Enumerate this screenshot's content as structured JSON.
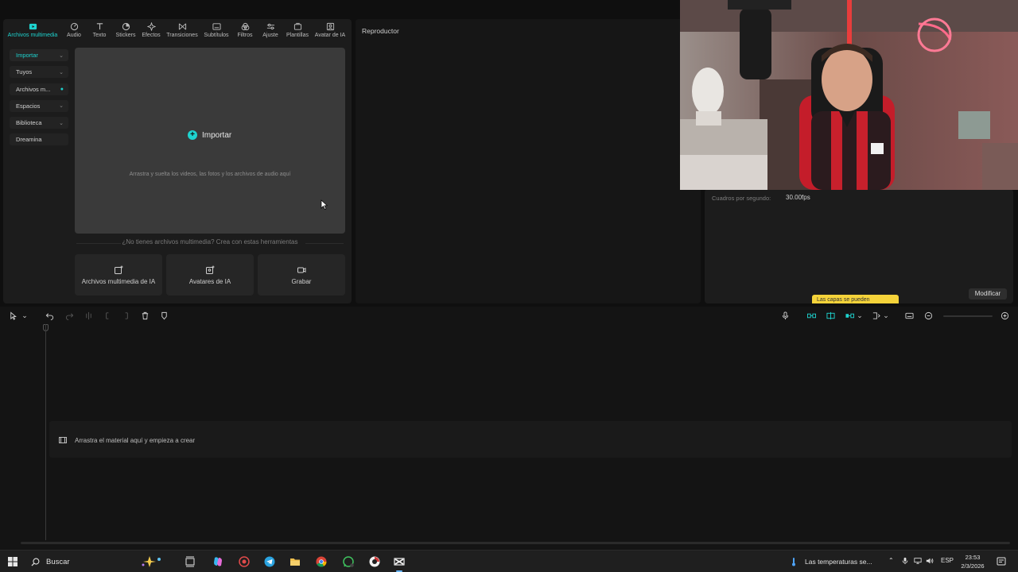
{
  "media_tabs": [
    {
      "label": "Archivos multimedia",
      "icon": "media-icon",
      "active": true
    },
    {
      "label": "Audio",
      "icon": "audio-icon"
    },
    {
      "label": "Texto",
      "icon": "text-icon"
    },
    {
      "label": "Stickers",
      "icon": "sticker-icon"
    },
    {
      "label": "Efectos",
      "icon": "effects-icon"
    },
    {
      "label": "Transiciones",
      "icon": "transitions-icon"
    },
    {
      "label": "Subtítulos",
      "icon": "subtitles-icon"
    },
    {
      "label": "Filtros",
      "icon": "filters-icon"
    },
    {
      "label": "Ajuste",
      "icon": "adjust-icon"
    },
    {
      "label": "Plantillas",
      "icon": "templates-icon"
    },
    {
      "label": "Avatar de IA",
      "icon": "ai-avatar-icon"
    }
  ],
  "sidebar": {
    "items": [
      {
        "label": "Importar",
        "active": true
      },
      {
        "label": "Tuyos"
      },
      {
        "label": "Archivos m..."
      },
      {
        "label": "Espacios"
      },
      {
        "label": "Biblioteca"
      },
      {
        "label": "Dreamina"
      }
    ]
  },
  "import": {
    "button_label": "Importar",
    "hint": "Arrastra y suelta los videos, las fotos y los archivos de audio aquí"
  },
  "empty_prompt": "¿No tienes archivos multimedia? Crea con estas herramientas",
  "tools": [
    {
      "label": "Archivos multimedia de IA",
      "icon": "ai-media-icon"
    },
    {
      "label": "Avatares de IA",
      "icon": "ai-avatars-icon"
    },
    {
      "label": "Grabar",
      "icon": "record-icon"
    }
  ],
  "player": {
    "title": "Reproductor"
  },
  "details": {
    "fps_label": "Cuadros por segundo:",
    "fps_value": "30.00fps",
    "tooltip": "Las capas se pueden",
    "modify_label": "Modificar"
  },
  "timeline": {
    "drop_hint": "Arrastra el material aquí y empieza a crear"
  },
  "taskbar": {
    "search_placeholder": "Buscar",
    "weather_text": "Las temperaturas se...",
    "language": "ESP",
    "time": "23:53",
    "date": "2/3/2026"
  },
  "colors": {
    "accent": "#1ed3cf",
    "background": "#0f0f0f",
    "panel": "#1c1c1c",
    "tooltip": "#f5d33a"
  }
}
